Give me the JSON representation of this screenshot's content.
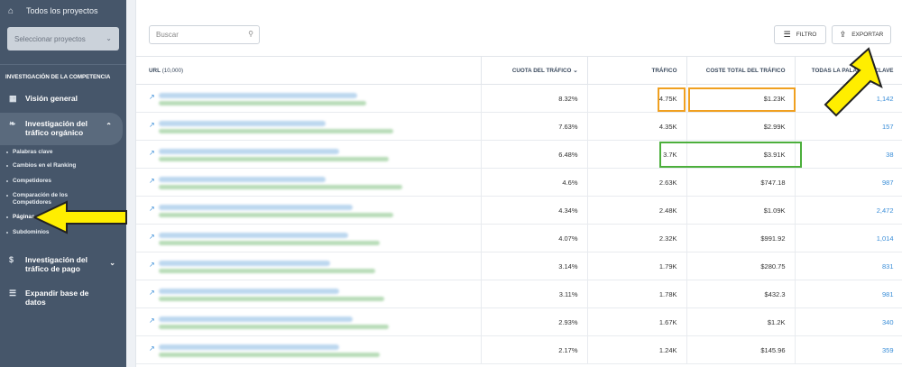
{
  "sidebar": {
    "top_item": "Todos los proyectos",
    "project_select_placeholder": "Seleccionar proyectos",
    "section_title": "INVESTIGACIÓN DE LA COMPETENCIA",
    "items": [
      {
        "label": "Visión general"
      },
      {
        "label_line1": "Investigación del",
        "label_line2": "tráfico orgánico"
      },
      {
        "label_line1": "Investigación del",
        "label_line2": "tráfico de pago"
      },
      {
        "label_line1": "Expandir base de",
        "label_line2": "datos"
      }
    ],
    "subitems": [
      {
        "label": "Palabras clave"
      },
      {
        "label": "Cambios en el Ranking"
      },
      {
        "label": "Competidores"
      },
      {
        "label_line1": "Comparación de los",
        "label_line2": "Competidores"
      },
      {
        "label": "Páginas"
      },
      {
        "label": "Subdominios"
      }
    ]
  },
  "toolbar": {
    "search_placeholder": "Buscar",
    "filter_label": "FILTRO",
    "export_label": "EXPORTAR"
  },
  "table": {
    "headers": {
      "url": "URL",
      "url_count": "(10,000)",
      "share": "CUOTA DEL TRÁFICO",
      "traffic": "TRÁFICO",
      "cost": "COSTE TOTAL DEL TRÁFICO",
      "keywords": "TODAS LA PALABRAS CLAVE"
    },
    "rows": [
      {
        "share": "8.32%",
        "traffic": "4.75K",
        "cost": "$1.23K",
        "keywords": "1,142"
      },
      {
        "share": "7.63%",
        "traffic": "4.35K",
        "cost": "$2.99K",
        "keywords": "157"
      },
      {
        "share": "6.48%",
        "traffic": "3.7K",
        "cost": "$3.91K",
        "keywords": "38"
      },
      {
        "share": "4.6%",
        "traffic": "2.63K",
        "cost": "$747.18",
        "keywords": "987"
      },
      {
        "share": "4.34%",
        "traffic": "2.48K",
        "cost": "$1.09K",
        "keywords": "2,472"
      },
      {
        "share": "4.07%",
        "traffic": "2.32K",
        "cost": "$991.92",
        "keywords": "1,014"
      },
      {
        "share": "3.14%",
        "traffic": "1.79K",
        "cost": "$280.75",
        "keywords": "831"
      },
      {
        "share": "3.11%",
        "traffic": "1.78K",
        "cost": "$432.3",
        "keywords": "981"
      },
      {
        "share": "2.93%",
        "traffic": "1.67K",
        "cost": "$1.2K",
        "keywords": "340"
      },
      {
        "share": "2.17%",
        "traffic": "1.24K",
        "cost": "$145.96",
        "keywords": "359"
      }
    ]
  },
  "colors": {
    "sidebar_bg": "#46566a",
    "link": "#3a8ed8",
    "highlight_orange": "#f0a020",
    "highlight_green": "#4caf3c",
    "arrow_yellow": "#ffee00"
  }
}
